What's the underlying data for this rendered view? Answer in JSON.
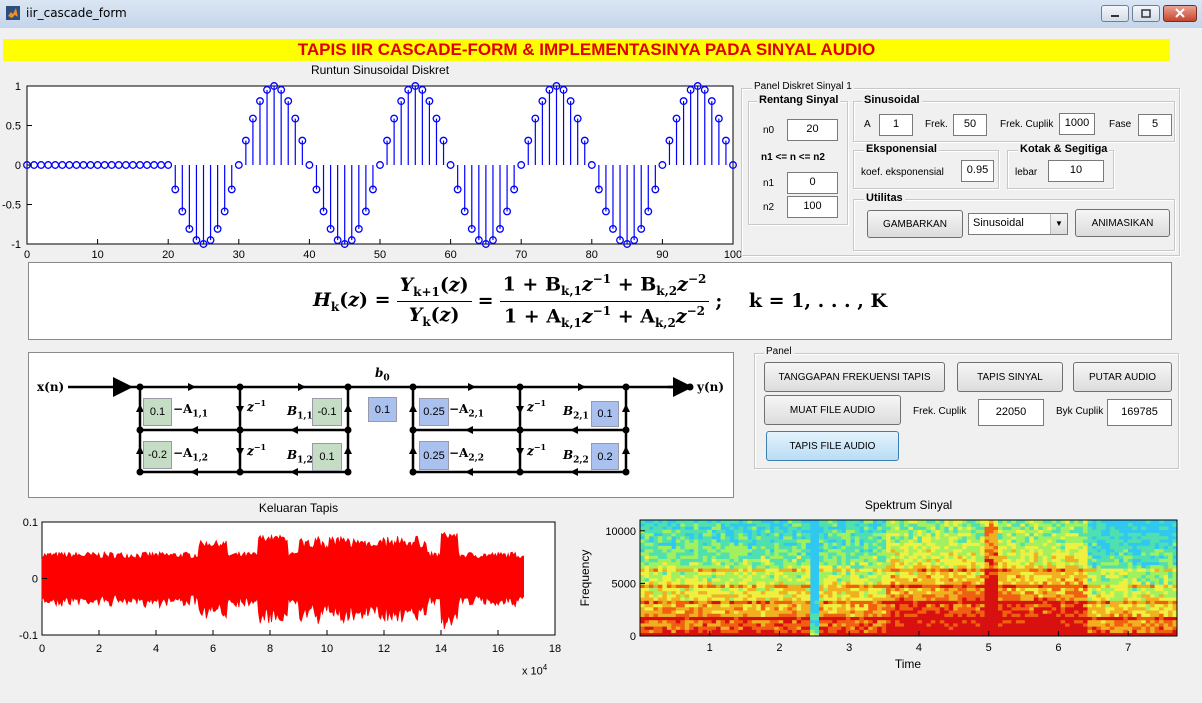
{
  "window": {
    "title": "iir_cascade_form"
  },
  "banner": {
    "text": "TAPIS IIR CASCADE-FORM & IMPLEMENTASINYA PADA SINYAL AUDIO"
  },
  "top_plot": {
    "title": "Runtun Sinusoidal Diskret",
    "xticks": [
      "0",
      "10",
      "20",
      "30",
      "40",
      "50",
      "60",
      "70",
      "80",
      "90",
      "100"
    ],
    "yticks": [
      "1",
      "0.5",
      "0",
      "-0.5",
      "-1"
    ],
    "color": "#0000ff"
  },
  "panel_diskret": {
    "title": "Panel Diskret Sinyal 1",
    "rentang": {
      "title": "Rentang Sinyal",
      "n0_label": "n0",
      "n0": "20",
      "range_label": "n1 <= n <= n2",
      "n1_label": "n1",
      "n1": "0",
      "n2_label": "n2",
      "n2": "100"
    },
    "sinusoidal": {
      "title": "Sinusoidal",
      "a_label": "A",
      "a": "1",
      "frek_label": "Frek.",
      "frek": "50",
      "cuplik_label": "Frek. Cuplik",
      "cuplik": "1000",
      "fase_label": "Fase",
      "fase": "5"
    },
    "eksponensial": {
      "title": "Eksponensial",
      "koef_label": "koef. eksponensial",
      "koef": "0.95"
    },
    "kotak": {
      "title": "Kotak & Segitiga",
      "lebar_label": "lebar",
      "lebar": "10"
    },
    "utilitas": {
      "title": "Utilitas",
      "gambarkan": "GAMBARKAN",
      "signal_type": "Sinusoidal",
      "animasikan": "ANIMASIKAN"
    }
  },
  "formula": {
    "lhs": "H",
    "k_sub": "k",
    "num1": "Y",
    "num1_sub": "k+1",
    "den1": "Y",
    "den1_sub": "k",
    "num2": "1 + B",
    "num2_sub1": "k,1",
    "num2_mid": "z",
    "num2_mid_exp": "−1",
    "num2_plus": " + B",
    "num2_sub2": "k,2",
    "num2_end": "z",
    "num2_end_exp": "−2",
    "den2": "1 + A",
    "den2_sub1": "k,1",
    "den2_mid": "z",
    "den2_mid_exp": "−1",
    "den2_plus": " + A",
    "den2_sub2": "k,2",
    "den2_end": "z",
    "den2_end_exp": "−2",
    "tail": "k = 1, . . . , K"
  },
  "diagram": {
    "xn": "x(n)",
    "yn": "y(n)",
    "b0": "b",
    "b0_sub": "0",
    "zinv": "z",
    "zinv_exp": "−1",
    "neg_a11": "−A",
    "neg_a11_sub": "1,1",
    "neg_a12": "−A",
    "neg_a12_sub": "1,2",
    "b11": "B",
    "b11_sub": "1,1",
    "b12": "B",
    "b12_sub": "1,2",
    "neg_a21": "−A",
    "neg_a21_sub": "2,1",
    "neg_a22": "−A",
    "neg_a22_sub": "2,2",
    "b21": "B",
    "b21_sub": "2,1",
    "b22": "B",
    "b22_sub": "2,2",
    "coef_a11": "0.1",
    "coef_a12": "-0.2",
    "coef_b11": "-0.1",
    "coef_b12": "0.1",
    "coef_b0": "0.1",
    "coef_a21": "0.25",
    "coef_a22": "0.25",
    "coef_b21": "0.1",
    "coef_b22": "0.2"
  },
  "panel_audio": {
    "title": "Panel",
    "tanggapan": "TANGGAPAN FREKUENSI TAPIS",
    "tapis_sinyal": "TAPIS SINYAL",
    "putar": "PUTAR AUDIO",
    "muat": "MUAT FILE AUDIO",
    "frek_cuplik_label": "Frek. Cuplik",
    "frek_cuplik": "22050",
    "byk_cuplik_label": "Byk Cuplik",
    "byk_cuplik": "169785",
    "tapis_file": "TAPIS FILE AUDIO"
  },
  "bottom_left_plot": {
    "title": "Keluaran Tapis",
    "xticks": [
      "0",
      "2",
      "4",
      "6",
      "8",
      "10",
      "12",
      "14",
      "16",
      "18"
    ],
    "yticks": [
      "0.1",
      "0",
      "-0.1"
    ],
    "xscale": "x 10",
    "xscale_exp": "4",
    "color": "#ff0000"
  },
  "bottom_right_plot": {
    "title": "Spektrum Sinyal",
    "xticks": [
      "1",
      "2",
      "3",
      "4",
      "5",
      "6",
      "7"
    ],
    "yticks": [
      "10000",
      "5000",
      "0"
    ],
    "xlabel": "Time",
    "ylabel": "Frequency"
  }
}
